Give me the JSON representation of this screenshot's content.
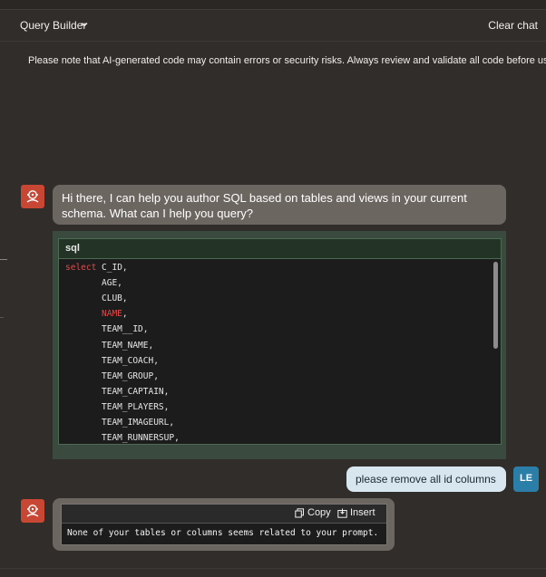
{
  "header": {
    "title": "Query Builder",
    "clear_label": "Clear chat"
  },
  "notice": "Please note that AI-generated code may contain errors or security risks. Always review and validate all code before use.",
  "messages": {
    "greeting": "Hi there, I can help you author SQL based on tables and views in your current schema. What can I help you query?",
    "code_block": {
      "language": "sql",
      "lines": [
        {
          "keyword": "select",
          "text": "C_ID,"
        },
        {
          "text": "AGE,"
        },
        {
          "text": "CLUB,"
        },
        {
          "keyword": "NAME",
          "text": ","
        },
        {
          "text": "TEAM__ID,"
        },
        {
          "text": "TEAM_NAME,"
        },
        {
          "text": "TEAM_COACH,"
        },
        {
          "text": "TEAM_GROUP,"
        },
        {
          "text": "TEAM_CAPTAIN,"
        },
        {
          "text": "TEAM_PLAYERS,"
        },
        {
          "text": "TEAM_IMAGEURL,"
        },
        {
          "text": "TEAM_RUNNERSUP,"
        }
      ]
    },
    "user_prompt": "please remove all id columns",
    "user_initials": "LE",
    "response": {
      "copy_label": "Copy",
      "insert_label": "Insert",
      "text": "None of your tables or columns seems related to your prompt."
    }
  },
  "icons": {
    "ai_avatar": "ai-assistant-icon",
    "chevron": "chevron-down-icon",
    "copy": "copy-icon",
    "insert": "insert-icon"
  },
  "colors": {
    "ai_avatar": "#c74634",
    "user_avatar": "#2a7ea8",
    "keyword": "#e04a4a",
    "user_bubble": "#d8e6ef"
  }
}
